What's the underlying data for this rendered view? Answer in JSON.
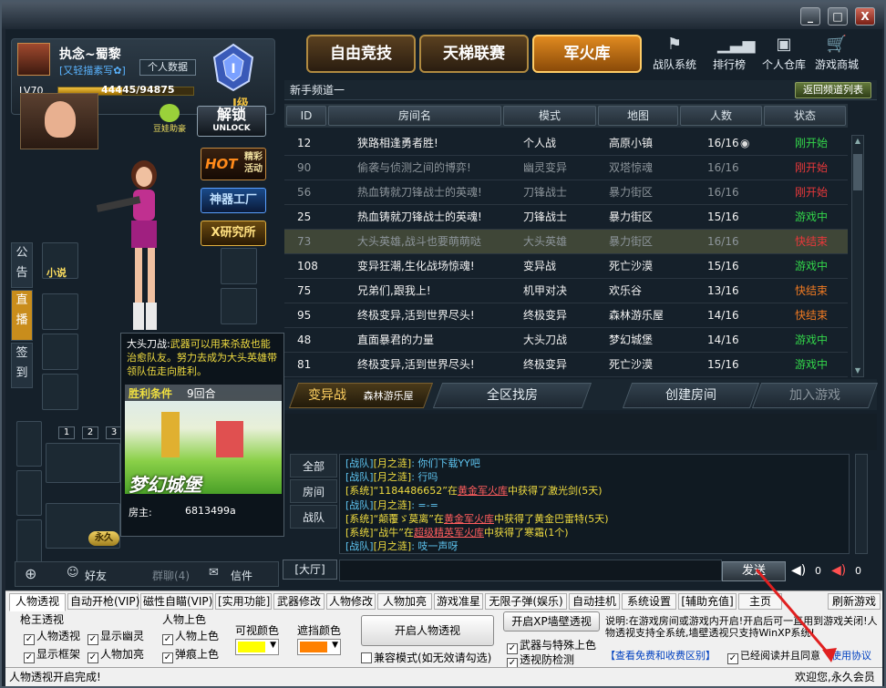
{
  "window": {
    "min": "_",
    "max": "□",
    "close": "X"
  },
  "profile": {
    "name": "执念~蜀黎",
    "tag": "[又轻描素写✿]",
    "btn": "个人数据",
    "level": "LV70",
    "exp": "44445/94875",
    "exp_ratio": 0.47,
    "rank": "I级",
    "rank_level": "I",
    "unlock": "解锁",
    "unlock_sub": "UNLOCK",
    "helper": "豆娃助豪"
  },
  "left_promos": {
    "hot": "HOT",
    "hot_text": "精彩活动",
    "factory": "神器工厂",
    "lab": "X研究所"
  },
  "side_tabs": {
    "notice": "公告",
    "live": "直播",
    "sign": "签到"
  },
  "slot_novel": "小说",
  "inventory": {
    "pages": [
      "1",
      "2",
      "3"
    ],
    "forever": "永久"
  },
  "social": {
    "friends": "好友",
    "group": "群聊(4)",
    "mail": "信件"
  },
  "top_tabs": [
    {
      "label": "自由竞技",
      "active": false
    },
    {
      "label": "天梯联赛",
      "active": false
    },
    {
      "label": "军火库",
      "active": true
    }
  ],
  "top_icons": [
    {
      "label": "战队系统",
      "icon": "flag-icon"
    },
    {
      "label": "排行榜",
      "icon": "bar-chart-icon"
    },
    {
      "label": "个人仓库",
      "icon": "box-icon"
    },
    {
      "label": "游戏商城",
      "icon": "cart-icon"
    }
  ],
  "channel": {
    "label": "新手频道一",
    "back": "返回频道列表"
  },
  "table": {
    "headers": [
      "ID",
      "房间名",
      "模式",
      "地图",
      "人数",
      "状态"
    ],
    "rows": [
      {
        "id": "12",
        "name": "狭路相逢勇者胜!",
        "mode": "个人战",
        "map": "高原小镇",
        "count": "16/16",
        "status": "刚开始",
        "status_color": "green",
        "dim": false,
        "sel": false,
        "eye": true
      },
      {
        "id": "90",
        "name": "偷袭与侦测之间的博弈!",
        "mode": "幽灵变异",
        "map": "双塔惊魂",
        "count": "16/16",
        "status": "刚开始",
        "status_color": "red",
        "dim": true,
        "sel": false,
        "eye": false
      },
      {
        "id": "56",
        "name": "热血铸就刀锋战士的英魂!",
        "mode": "刀锋战士",
        "map": "暴力街区",
        "count": "16/16",
        "status": "刚开始",
        "status_color": "red",
        "dim": true,
        "sel": false,
        "eye": false
      },
      {
        "id": "25",
        "name": "热血铸就刀锋战士的英魂!",
        "mode": "刀锋战士",
        "map": "暴力街区",
        "count": "15/16",
        "status": "游戏中",
        "status_color": "green",
        "dim": false,
        "sel": false,
        "eye": false
      },
      {
        "id": "73",
        "name": "大头英雄,战斗也要萌萌哒",
        "mode": "大头英雄",
        "map": "暴力街区",
        "count": "16/16",
        "status": "快结束",
        "status_color": "red",
        "dim": true,
        "sel": true,
        "eye": false
      },
      {
        "id": "108",
        "name": "变异狂潮,生化战场惊魂!",
        "mode": "变异战",
        "map": "死亡沙漠",
        "count": "15/16",
        "status": "游戏中",
        "status_color": "green",
        "dim": false,
        "sel": false,
        "eye": false
      },
      {
        "id": "75",
        "name": "兄弟们,跟我上!",
        "mode": "机甲对决",
        "map": "欢乐谷",
        "count": "13/16",
        "status": "快结束",
        "status_color": "orange",
        "dim": false,
        "sel": false,
        "eye": false
      },
      {
        "id": "95",
        "name": "终极变异,活到世界尽头!",
        "mode": "终极变异",
        "map": "森林游乐屋",
        "count": "14/16",
        "status": "快结束",
        "status_color": "orange",
        "dim": false,
        "sel": false,
        "eye": false
      },
      {
        "id": "48",
        "name": "直面暴君的力量",
        "mode": "大头刀战",
        "map": "梦幻城堡",
        "count": "14/16",
        "status": "游戏中",
        "status_color": "green",
        "dim": false,
        "sel": false,
        "eye": false
      },
      {
        "id": "81",
        "name": "终极变异,活到世界尽头!",
        "mode": "终极变异",
        "map": "死亡沙漠",
        "count": "15/16",
        "status": "游戏中",
        "status_color": "green",
        "dim": false,
        "sel": false,
        "eye": false
      }
    ]
  },
  "actions": {
    "filter": "变异战",
    "filter_map": "森林游乐屋",
    "find": "全区找房",
    "create": "创建房间",
    "join": "加入游戏"
  },
  "tooltip": {
    "mode": "大头刀战:",
    "desc": "武器可以用来杀敌也能治愈队友。努力去成为大头英雄带领队伍走向胜利。",
    "win_label": "胜利条件",
    "win_value": "9回合",
    "map_title": "梦幻城堡",
    "host_label": "房主:",
    "host_value": "6813499a"
  },
  "chat_tabs": [
    "全部",
    "房间",
    "战队"
  ],
  "chat_lines": [
    {
      "prefix": "[战队]",
      "who": "[月之涟]",
      "text": ": 你们下载YY吧"
    },
    {
      "prefix": "[战队]",
      "who": "[月之涟]",
      "text": ": 行吗"
    },
    {
      "prefix": "[系统]",
      "who": "“1184486652”",
      "mid": "在",
      "link": "黄金军火库",
      "tail": "中获得了激光剑(5天)"
    },
    {
      "prefix": "[战队]",
      "who": "[月之涟]",
      "text": ": =-="
    },
    {
      "prefix": "[系统]",
      "who": "“颠覆ゞ莫离”",
      "mid": "在",
      "link": "黄金军火库",
      "tail": "中获得了黄金巴雷特(5天)"
    },
    {
      "prefix": "[系统]",
      "who": "“战牛”",
      "mid": "在",
      "link": "超级精英军火库",
      "tail": "中获得了寒霜(1个)"
    },
    {
      "prefix": "[战队]",
      "who": "[月之涟]",
      "text": ": 吱一声呀"
    }
  ],
  "chat": {
    "channel": "[大厅]",
    "send": "发送",
    "speaker1": "0",
    "speaker2": "0"
  },
  "cheat": {
    "tabs": [
      "人物透视",
      "自动开枪(VIP)",
      "磁性自瞄(VIP)",
      "[实用功能]",
      "武器修改",
      "人物修改",
      "人物加亮",
      "游戏准星",
      "无限子弹(娱乐)",
      "自动挂机",
      "系统设置",
      "[辅助充值]",
      "主页"
    ],
    "refresh": "刷新游戏",
    "group1": "枪王透视",
    "g1": [
      "人物透视",
      "显示幽灵",
      "显示框架",
      "人物加亮"
    ],
    "group2": "人物上色",
    "g2": [
      "人物上色",
      "弹痕上色"
    ],
    "visible_color": "可视颜色",
    "hidden_color": "遮挡颜色",
    "visible_hex": "#ffff00",
    "hidden_hex": "#ff8000",
    "open_btn": "开启人物透视",
    "compat": "兼容模式(如无效请勾选)",
    "xp_btn": "开启XP墙壁透视",
    "weapon_color": "武器与特殊上色",
    "anti": "透视防检测",
    "note": "说明:在游戏房间或游戏内开启!开启后可一直用到游戏关闭!人物透视支持全系统,墙壁透视只支持WinXP系统!",
    "link_view": "【查看免费和收费区别】",
    "agree": "已经阅读并且同意",
    "agreement": "使用协议"
  },
  "status": {
    "left": "人物透视开启完成!",
    "right": "欢迎您,永久会员"
  }
}
